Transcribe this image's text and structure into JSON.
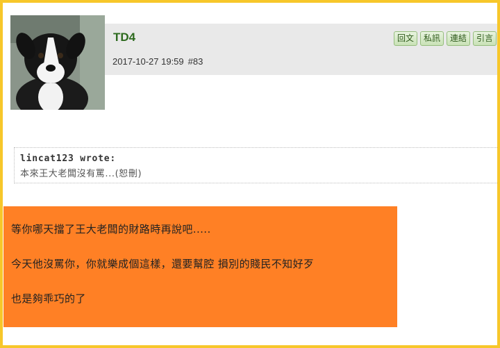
{
  "post": {
    "username": "TD4",
    "date": "2017-10-27 19:59",
    "post_number": "#83",
    "avatar_icon": "puppy-avatar"
  },
  "actions": [
    {
      "label": "回文",
      "icon": "reply"
    },
    {
      "label": "私訊",
      "icon": "private-message"
    },
    {
      "label": "連結",
      "icon": "link"
    },
    {
      "label": "引言",
      "icon": "quote"
    }
  ],
  "quote": {
    "author": "lincat123 wrote:",
    "text": "本來王大老闆沒有罵...(恕刪)"
  },
  "message": {
    "lines": [
      "等你哪天擋了王大老闆的財路時再說吧.....",
      "今天他沒罵你，你就樂成個這樣，還要幫腔 損別的賤民不知好歹",
      "也是夠乖巧的了"
    ],
    "background": "#ff8025"
  },
  "colors": {
    "frame": "#f7c72a",
    "username": "#2d6a1e",
    "header_bg": "#e9e9e9"
  }
}
